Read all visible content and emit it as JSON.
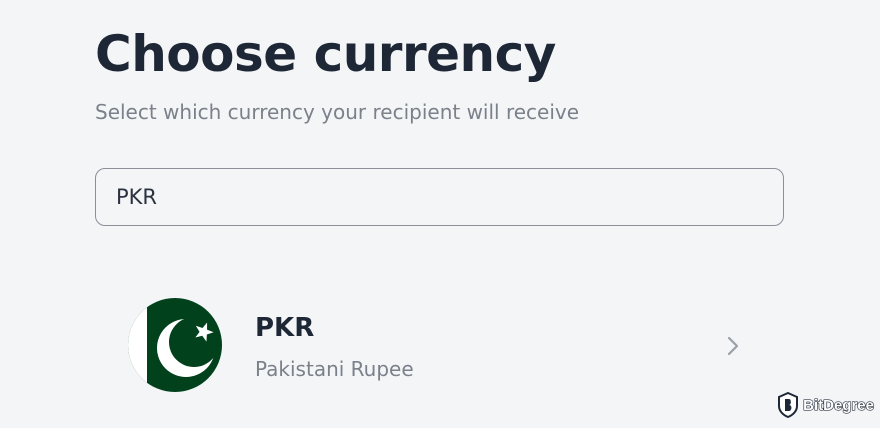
{
  "header": {
    "title": "Choose currency",
    "subtitle": "Select which currency your recipient will receive"
  },
  "search": {
    "value": "PKR",
    "placeholder": ""
  },
  "results": [
    {
      "code": "PKR",
      "name": "Pakistani Rupee",
      "flag_icon": "pakistan-flag-icon",
      "action_icon": "chevron-right-icon"
    }
  ],
  "watermark": {
    "text": "BitDegree",
    "icon": "bitdegree-logo-icon"
  },
  "colors": {
    "background": "#f4f5f7",
    "title": "#1e2736",
    "muted_text": "#7b818b",
    "input_border": "#8a8f98",
    "flag_green": "#01411c",
    "flag_white": "#ffffff"
  }
}
